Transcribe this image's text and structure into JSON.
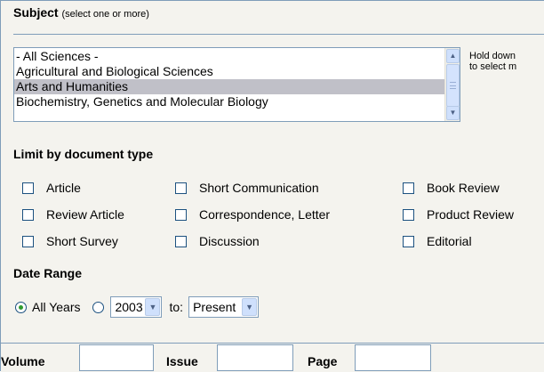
{
  "subject": {
    "title": "Subject",
    "hint": "(select one or more)",
    "options": [
      {
        "label": "- All Sciences -",
        "selected": false
      },
      {
        "label": "Agricultural and Biological Sciences",
        "selected": false
      },
      {
        "label": "Arts and Humanities",
        "selected": true
      },
      {
        "label": "Biochemistry, Genetics and Molecular Biology",
        "selected": false
      }
    ],
    "help_line1": "Hold down",
    "help_line2": "to select m"
  },
  "doctype": {
    "title": "Limit by document type",
    "rows": [
      [
        "Article",
        "Short Communication",
        "Book Review"
      ],
      [
        "Review Article",
        "Correspondence, Letter",
        "Product Review"
      ],
      [
        "Short Survey",
        "Discussion",
        "Editorial"
      ]
    ]
  },
  "date_range": {
    "title": "Date Range",
    "all_years_label": "All Years",
    "from_value": "2003",
    "to_label": "to:",
    "to_value": "Present"
  },
  "citation": {
    "volume_label": "Volume",
    "issue_label": "Issue",
    "page_label": "Page"
  },
  "colors": {
    "panel_bg": "#f4f3ee",
    "border": "#7f9db9",
    "selected_row": "#c0c0c8",
    "radio_dot": "#2f9b2f"
  }
}
